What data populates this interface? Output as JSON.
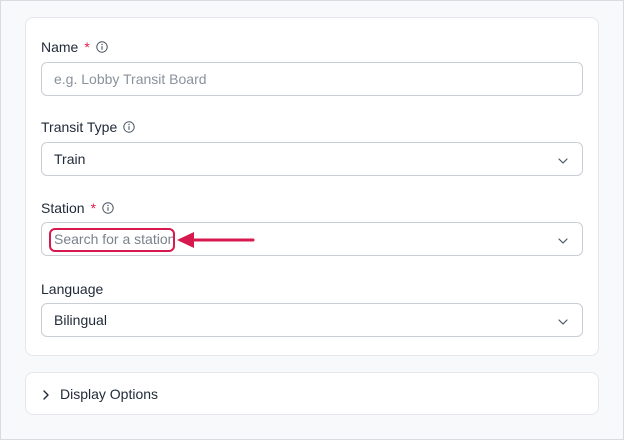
{
  "form": {
    "name": {
      "label": "Name",
      "required_mark": "*",
      "placeholder": "e.g. Lobby Transit Board"
    },
    "transit_type": {
      "label": "Transit Type",
      "value": "Train"
    },
    "station": {
      "label": "Station",
      "required_mark": "*",
      "placeholder": "Search for a station"
    },
    "language": {
      "label": "Language",
      "value": "Bilingual"
    }
  },
  "display_options": {
    "title": "Display Options"
  },
  "colors": {
    "required": "#e11d48",
    "annotation": "#d8194f",
    "border": "#c9ced6"
  },
  "icons": {
    "info": "info-circle-icon",
    "dropdown": "chevron-down-icon",
    "expand": "chevron-right-icon"
  }
}
